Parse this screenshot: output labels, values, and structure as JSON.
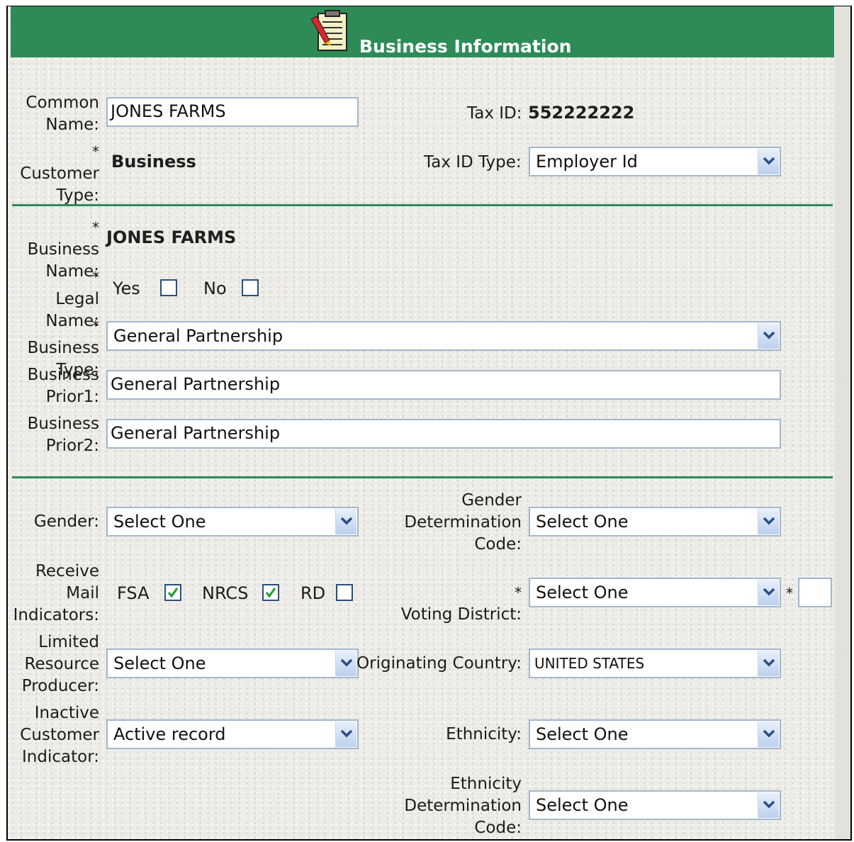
{
  "header": {
    "title": "Business Information"
  },
  "customer": {
    "common_name_label": [
      "Common",
      "Name:"
    ],
    "common_name_value": "JONES FARMS",
    "tax_id_label": "Tax ID:",
    "tax_id_value": "552222222",
    "customer_type_label": [
      "Customer",
      "Type:"
    ],
    "customer_type_value": "Business",
    "tax_id_type_label": "Tax ID Type:",
    "tax_id_type_value": "Employer Id"
  },
  "business": {
    "business_name_label": [
      "Business",
      "Name:"
    ],
    "business_name_value": "JONES FARMS",
    "legal_name_label": [
      "Legal",
      "Name:"
    ],
    "legal_yes": "Yes",
    "legal_no": "No",
    "business_type_label": [
      "Business",
      "Type:"
    ],
    "business_type_value": "General Partnership",
    "prior1_label": [
      "Business",
      "Prior1:"
    ],
    "prior1_value": "General Partnership",
    "prior2_label": [
      "Business",
      "Prior2:"
    ],
    "prior2_value": "General Partnership"
  },
  "details": {
    "gender_label": "Gender:",
    "gender_value": "Select One",
    "gender_det_label": [
      "Gender",
      "Determination",
      "Code:"
    ],
    "gender_det_value": "Select One",
    "mail_label": [
      "Receive",
      "Mail",
      "Indicators:"
    ],
    "mail_fsa": "FSA",
    "mail_nrcs": "NRCS",
    "mail_rd": "RD",
    "voting_label": "Voting District:",
    "voting_value": "Select One",
    "lrp_label": [
      "Limited",
      "Resource",
      "Producer:"
    ],
    "lrp_value": "Select One",
    "country_label": "Originating Country:",
    "country_value": "UNITED STATES",
    "inactive_label": [
      "Inactive",
      "Customer",
      "Indicator:"
    ],
    "inactive_value": "Active record",
    "ethnicity_label": "Ethnicity:",
    "ethnicity_value": "Select One",
    "eth_det_label": [
      "Ethnicity",
      "Determination",
      "Code:"
    ],
    "eth_det_value": "Select One"
  },
  "required_marker": "*",
  "colors": {
    "header": "#2e8b57",
    "rule": "#2e8b57",
    "input_border": "#a3b6cc"
  }
}
